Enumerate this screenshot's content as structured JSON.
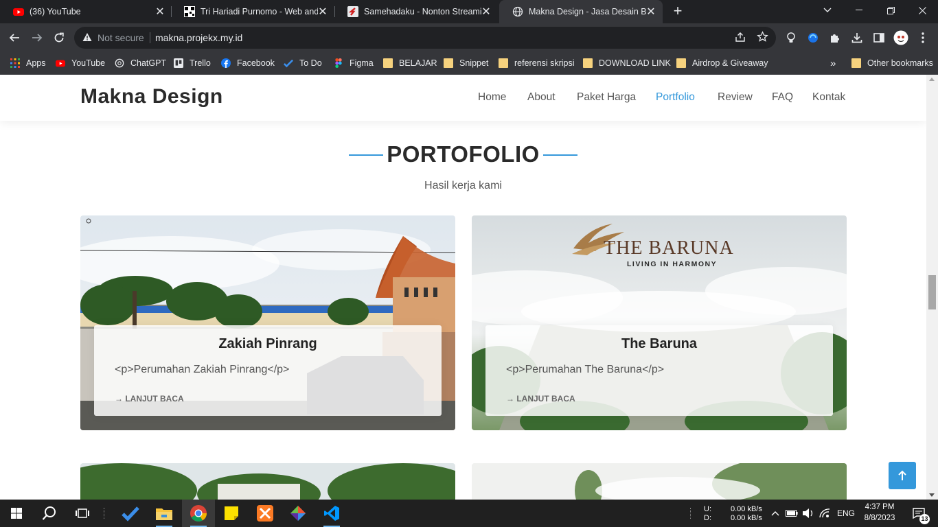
{
  "browser": {
    "tabs": [
      {
        "title": "(36) YouTube",
        "favicon": "youtube-icon"
      },
      {
        "title": "Tri Hariadi Purnomo - Web and M",
        "favicon": "qr-icon"
      },
      {
        "title": "Samehadaku - Nonton Streaming",
        "favicon": "samehadaku-icon"
      },
      {
        "title": "Makna Design - Jasa Desain Bang",
        "favicon": "globe-icon"
      }
    ],
    "not_secure": "Not secure",
    "url": "makna.projekx.my.id",
    "bookmarks": [
      {
        "label": "Apps",
        "icon": "apps-grid-icon"
      },
      {
        "label": "YouTube",
        "icon": "youtube-icon"
      },
      {
        "label": "ChatGPT",
        "icon": "chatgpt-icon"
      },
      {
        "label": "Trello",
        "icon": "trello-icon"
      },
      {
        "label": "Facebook",
        "icon": "facebook-icon"
      },
      {
        "label": "To Do",
        "icon": "todo-icon"
      },
      {
        "label": "Figma",
        "icon": "figma-icon"
      },
      {
        "label": "BELAJAR",
        "icon": "folder-icon"
      },
      {
        "label": "Snippet",
        "icon": "folder-icon"
      },
      {
        "label": "referensi skripsi",
        "icon": "folder-icon"
      },
      {
        "label": "DOWNLOAD LINK",
        "icon": "folder-icon"
      },
      {
        "label": "Airdrop & Giveaway",
        "icon": "folder-icon"
      }
    ],
    "other_bookmarks": "Other bookmarks",
    "overflow": "»"
  },
  "site": {
    "logo": "Makna Design",
    "nav": [
      "Home",
      "About",
      "Paket Harga",
      "Portfolio",
      "Review",
      "FAQ",
      "Kontak"
    ],
    "active_nav": "Portfolio",
    "accent": "#3498db",
    "section_title": "PORTOFOLIO",
    "section_subtitle": "Hasil kerja kami",
    "cards": [
      {
        "title": "Zakiah Pinrang",
        "desc": "<p>Perumahan Zakiah Pinrang</p>",
        "more": "→ LANJUT BACA"
      },
      {
        "title": "The Baruna",
        "desc": "<p>Perumahan The Baruna</p>",
        "more": "→ LANJUT BACA",
        "brand_title": "THE BARUNA",
        "brand_tagline": "LIVING IN HARMONY"
      }
    ]
  },
  "taskbar": {
    "net_up_label": "U:",
    "net_down_label": "D:",
    "net_up": "0.00 kB/s",
    "net_down": "0.00 kB/s",
    "lang": "ENG",
    "time": "4:37 PM",
    "date": "8/8/2023",
    "notifications": "13"
  }
}
